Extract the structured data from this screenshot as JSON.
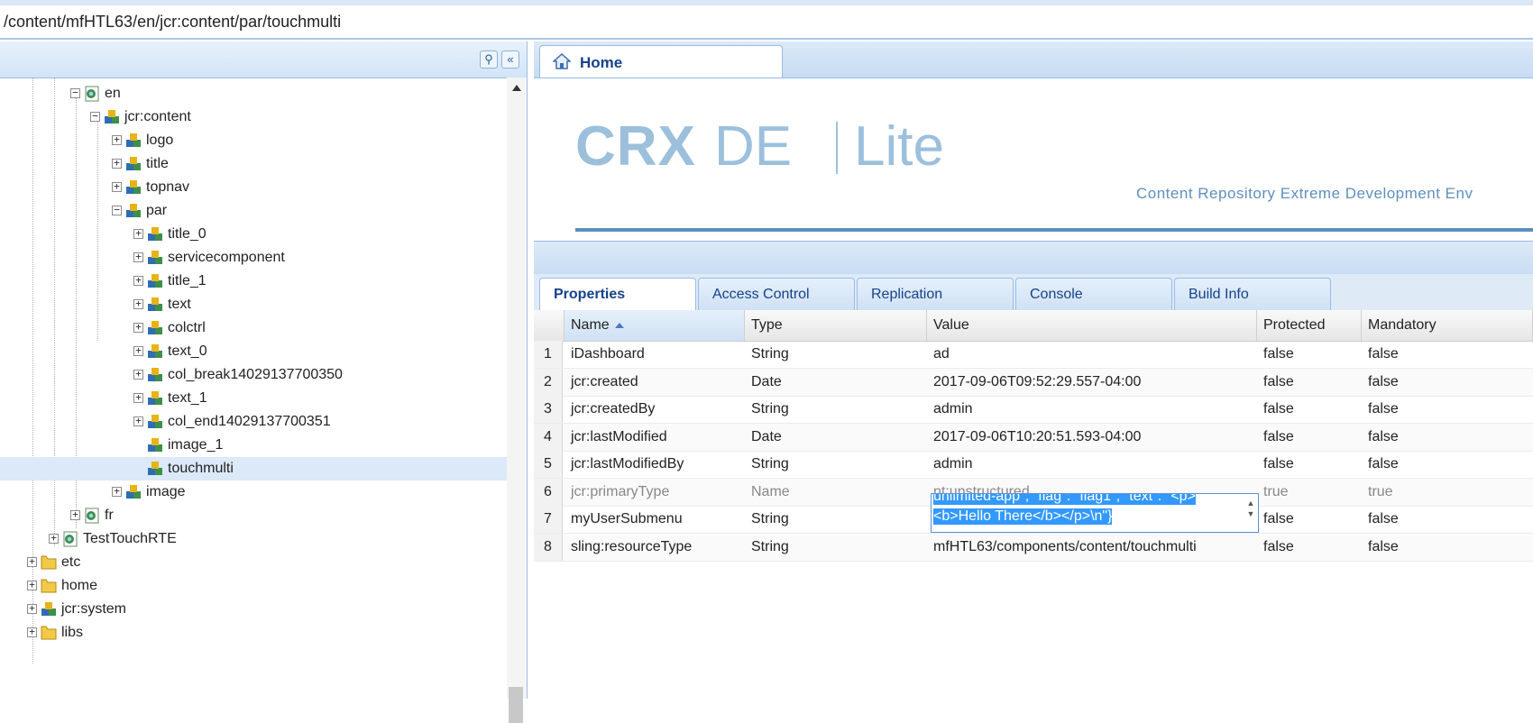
{
  "address": {
    "path": "/content/mfHTL63/en/jcr:content/par/touchmulti"
  },
  "tree": {
    "nodes": [
      {
        "label": "en",
        "icon": "page-icon",
        "exp": "−"
      },
      {
        "label": "jcr:content",
        "icon": "node-icon",
        "exp": "−"
      },
      {
        "label": "logo",
        "icon": "node-icon",
        "exp": "+"
      },
      {
        "label": "title",
        "icon": "node-icon",
        "exp": "+"
      },
      {
        "label": "topnav",
        "icon": "node-icon",
        "exp": "+"
      },
      {
        "label": "par",
        "icon": "node-icon",
        "exp": "−"
      },
      {
        "label": "title_0",
        "icon": "node-icon",
        "exp": "+"
      },
      {
        "label": "servicecomponent",
        "icon": "node-icon",
        "exp": "+"
      },
      {
        "label": "title_1",
        "icon": "node-icon",
        "exp": "+"
      },
      {
        "label": "text",
        "icon": "node-icon",
        "exp": "+"
      },
      {
        "label": "colctrl",
        "icon": "node-icon",
        "exp": "+"
      },
      {
        "label": "text_0",
        "icon": "node-icon",
        "exp": "+"
      },
      {
        "label": "col_break14029137700350",
        "icon": "node-icon",
        "exp": "+"
      },
      {
        "label": "text_1",
        "icon": "node-icon",
        "exp": "+"
      },
      {
        "label": "col_end14029137700351",
        "icon": "node-icon",
        "exp": "+"
      },
      {
        "label": "image_1",
        "icon": "node-icon",
        "exp": ""
      },
      {
        "label": "touchmulti",
        "icon": "node-icon",
        "exp": ""
      },
      {
        "label": "image",
        "icon": "node-icon",
        "exp": "+"
      },
      {
        "label": "fr",
        "icon": "page-icon",
        "exp": "+"
      },
      {
        "label": "TestTouchRTE",
        "icon": "page-icon",
        "exp": "+"
      },
      {
        "label": "etc",
        "icon": "folder-icon",
        "exp": "+"
      },
      {
        "label": "home",
        "icon": "folder-icon",
        "exp": "+"
      },
      {
        "label": "jcr:system",
        "icon": "node-icon",
        "exp": "+"
      },
      {
        "label": "libs",
        "icon": "folder-icon",
        "exp": "+"
      }
    ]
  },
  "hometab": {
    "label": "Home"
  },
  "logo": {
    "crx": "CRX",
    "de": "DE",
    "lite": "Lite",
    "tagline": "Content Repository Extreme Development Env"
  },
  "ptabs": [
    "Properties",
    "Access Control",
    "Replication",
    "Console",
    "Build Info"
  ],
  "grid": {
    "headers": [
      "Name",
      "Type",
      "Value",
      "Protected",
      "Mandatory"
    ],
    "rows": [
      {
        "n": "1",
        "name": "iDashboard",
        "type": "String",
        "value": "ad",
        "prot": "false",
        "mand": "false"
      },
      {
        "n": "2",
        "name": "jcr:created",
        "type": "Date",
        "value": "2017-09-06T09:52:29.557-04:00",
        "prot": "false",
        "mand": "false"
      },
      {
        "n": "3",
        "name": "jcr:createdBy",
        "type": "String",
        "value": "admin",
        "prot": "false",
        "mand": "false"
      },
      {
        "n": "4",
        "name": "jcr:lastModified",
        "type": "Date",
        "value": "2017-09-06T10:20:51.593-04:00",
        "prot": "false",
        "mand": "false"
      },
      {
        "n": "5",
        "name": "jcr:lastModifiedBy",
        "type": "String",
        "value": "admin",
        "prot": "false",
        "mand": "false"
      },
      {
        "n": "6",
        "name": "jcr:primaryType",
        "type": "Name",
        "value": "nt:unstructured",
        "prot": "true",
        "mand": "true"
      },
      {
        "n": "7",
        "name": "myUserSubmenu",
        "type": "String",
        "value": "",
        "prot": "false",
        "mand": "false"
      },
      {
        "n": "8",
        "name": "sling:resourceType",
        "type": "String",
        "value": "mfHTL63/components/content/touchmulti",
        "prot": "false",
        "mand": "false"
      }
    ],
    "editor": {
      "line1": "unlimited-app\", \"flag\": \"flag1\", \"text\": \"<p>",
      "line2": "<b>Hello There</b></p>\\n\"}"
    }
  }
}
